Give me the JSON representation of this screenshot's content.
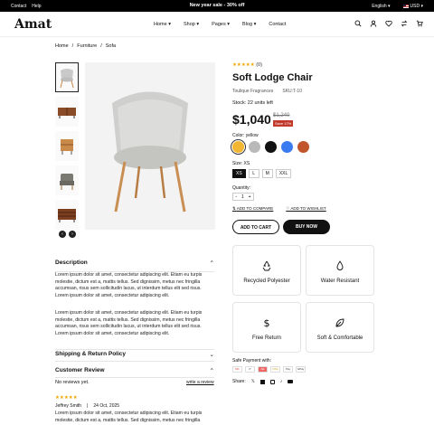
{
  "topbar": {
    "links": [
      "Contact",
      "Help"
    ],
    "promo": "New year sale - 30% off",
    "language": "English",
    "currency": "USD"
  },
  "header": {
    "logo": "Amat",
    "nav": [
      "Home",
      "Shop",
      "Pages",
      "Blog",
      "Contact"
    ],
    "cart_count": "0"
  },
  "breadcrumb": [
    "Home",
    "Furniture",
    "Sofa"
  ],
  "product": {
    "rating_stars": "★★★★★",
    "rating_count": "(0)",
    "title": "Soft Lodge Chair",
    "vendor": "Toulique Fragrances",
    "sku": "SKU:T-10",
    "stock": "Stock: 22 units left",
    "price": "$1,040",
    "old_price": "$1,240",
    "save": "Save 17%",
    "color_label": "Color: yellow",
    "colors": [
      "#f2b632",
      "#b9b9b9",
      "#111111",
      "#3a7cf0",
      "#c1552b"
    ],
    "size_label": "Size: XS",
    "sizes": [
      "XS",
      "L",
      "M",
      "XXL"
    ],
    "qty_label": "Quantity:",
    "qty": "1",
    "compare": "ADD TO COMPARE",
    "wishlist": "ADD TO WISHLIST",
    "add_to_cart": "ADD TO CART",
    "buy_now": "BUY NOW"
  },
  "features": [
    "Recycled Polyester",
    "Water Resistant",
    "Free Return",
    "Soft & Comfortable"
  ],
  "payment": {
    "label": "Safe Payment with:",
    "methods": [
      "MC",
      "P",
      "AE",
      "VISA",
      "Pay",
      "GPay"
    ]
  },
  "share_label": "Share:",
  "sections": {
    "description": "Description",
    "shipping": "Shipping & Return Policy",
    "review": "Customer Review"
  },
  "description": [
    "Lorem ipsum dolor sit amet, consectetur adipiscing elit. Etiam eu turpis molestie, dictum est a, mattis tellus. Sed dignissim, metus nec fringilla accumsan, risus sem sollicitudin lacus, ut interdum tellus elit sed risus. Lorem ipsum dolor sit amet, consectetur adipiscing elit.",
    "Lorem ipsum dolor sit amet, consectetur adipiscing elit. Etiam eu turpis molestie, dictum est a, mattis tellus. Sed dignissim, metus nec fringilla accumsan, risus sem sollicitudin lacus, ut interdum tellus elit sed risus. Lorem ipsum dolor sit amet, consectetur adipiscing elit."
  ],
  "reviews": {
    "none": "No reviews yet.",
    "write": "write a review",
    "stars": "★★★★★",
    "author": "Jeffrey Smith",
    "date": "24 Oct, 2025",
    "text": "Lorem ipsum dolor sit amet, consectetur adipiscing elit. Etiam eu turpis molestie, dictum est a, mattis tellus. Sed dignissim, metus nec fringilla"
  }
}
